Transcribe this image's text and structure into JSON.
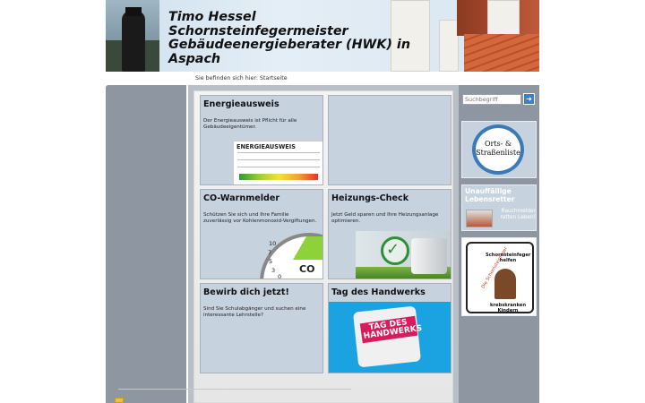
{
  "header": {
    "title": "Timo Hessel Schornsteinfegermeister Gebäudeenergieberater  (HWK) in Aspach"
  },
  "breadcrumb": "Sie befinden sich hier: Startseite",
  "tiles": [
    {
      "title": "Energieausweis",
      "text": "Der Energieausweis ist Pflicht für alle Gebäudeeigentümer.",
      "graphic_title": "ENERGIEAUSWEIS"
    },
    {
      "title": "",
      "text": ""
    },
    {
      "title": "CO-Warnmelder",
      "text": "Schützen Sie sich und Ihre Familie zuverlässig vor Kohlenmonoxid-Vergiftungen.",
      "graphic_label": "CO",
      "gauge_ticks": [
        "10",
        "7",
        "5",
        "3",
        "0"
      ]
    },
    {
      "title": "Heizungs-Check",
      "text": "Jetzt Geld sparen und Ihre Heizungsanlage optimieren.",
      "check_icon": "✓"
    },
    {
      "title": "Bewirb dich jetzt!",
      "text": "Sind Sie Schulabgänger und suchen eine interessante Lehrstelle?"
    },
    {
      "title": "Tag des Handwerks",
      "text": "",
      "graphic_label": "TAG DES HANDWERKS"
    }
  ],
  "sidebar": {
    "search_placeholder": "Suchbegriff",
    "search_button_icon": "➜",
    "orts_label": "Orts- & Straßenliste",
    "leben_title": "Unauffällige Lebensretter",
    "leben_text": "Rauchmelder retten Leben!",
    "krebs_top": "Schornsteinfeger helfen",
    "krebs_bottom": "krebskranken Kindern",
    "krebs_side": "Die Schornsteinfeger"
  },
  "colors": {
    "tile_bg": "#c7d2df",
    "sidebar_bg": "#8e97a1",
    "accent_blue": "#3a7fd0",
    "handwerk_blue": "#1aa3e0",
    "handwerk_pink": "#d81b5a"
  }
}
